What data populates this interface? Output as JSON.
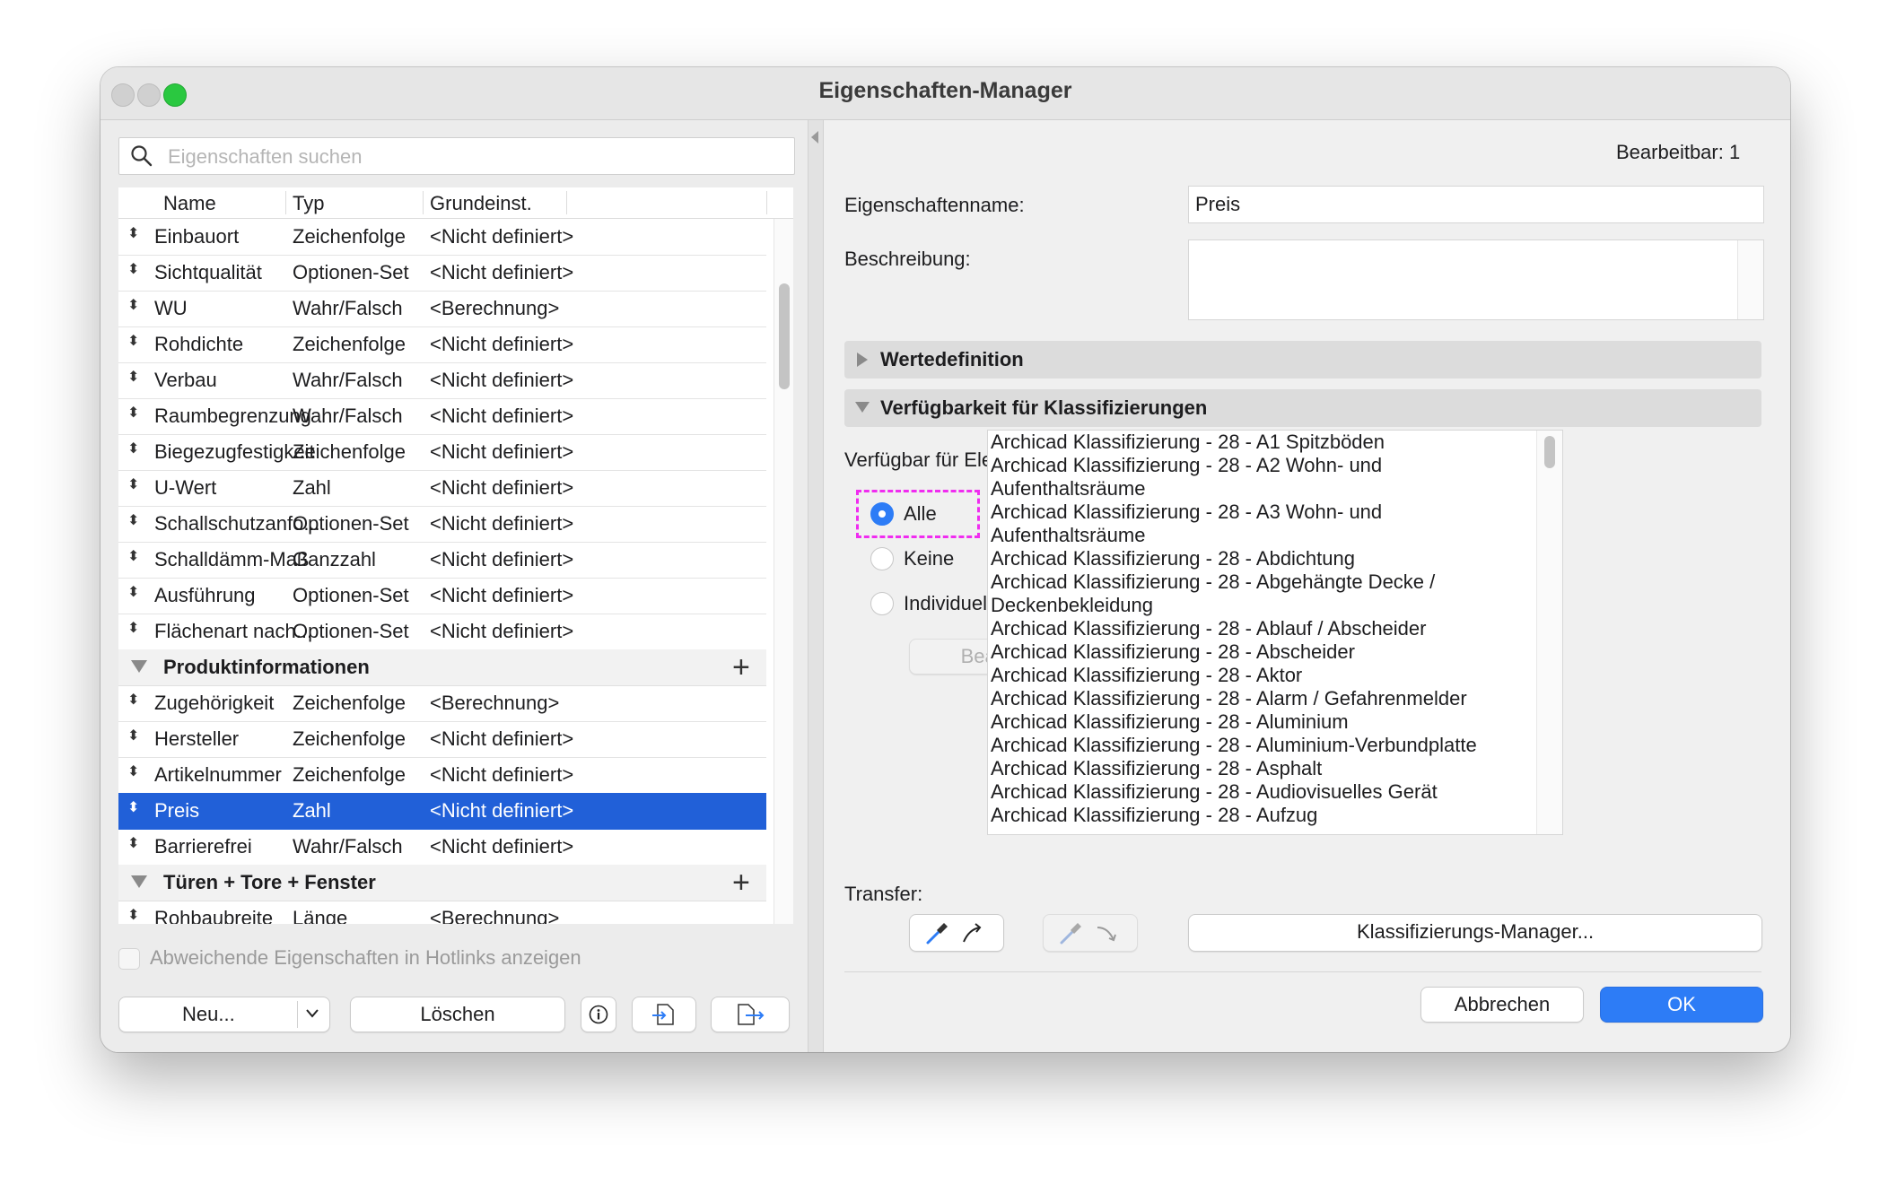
{
  "window": {
    "title": "Eigenschaften-Manager"
  },
  "search": {
    "placeholder": "Eigenschaften suchen"
  },
  "table": {
    "columns": [
      "Name",
      "Typ",
      "Grundeinst."
    ],
    "rows_top": [
      {
        "name": "Einbauort",
        "type": "Zeichenfolge",
        "default": "<Nicht definiert>"
      },
      {
        "name": "Sichtqualität",
        "type": "Optionen-Set",
        "default": "<Nicht definiert>"
      },
      {
        "name": "WU",
        "type": "Wahr/Falsch",
        "default": "<Berechnung>"
      },
      {
        "name": "Rohdichte",
        "type": "Zeichenfolge",
        "default": "<Nicht definiert>"
      },
      {
        "name": "Verbau",
        "type": "Wahr/Falsch",
        "default": "<Nicht definiert>"
      },
      {
        "name": "Raumbegrenzung",
        "type": "Wahr/Falsch",
        "default": "<Nicht definiert>"
      },
      {
        "name": "Biegezugfestigkeit",
        "type": "Zeichenfolge",
        "default": "<Nicht definiert>"
      },
      {
        "name": "U-Wert",
        "type": "Zahl",
        "default": "<Nicht definiert>"
      },
      {
        "name": "Schallschutzanfo...",
        "type": "Optionen-Set",
        "default": "<Nicht definiert>"
      },
      {
        "name": "Schalldämm-Maß",
        "type": "Ganzzahl",
        "default": "<Nicht definiert>"
      },
      {
        "name": "Ausführung",
        "type": "Optionen-Set",
        "default": "<Nicht definiert>"
      },
      {
        "name": "Flächenart nach...",
        "type": "Optionen-Set",
        "default": "<Nicht definiert>"
      }
    ],
    "group1": "Produktinformationen",
    "rows_group1": [
      {
        "name": "Zugehörigkeit",
        "type": "Zeichenfolge",
        "default": "<Berechnung>"
      },
      {
        "name": "Hersteller",
        "type": "Zeichenfolge",
        "default": "<Nicht definiert>"
      },
      {
        "name": "Artikelnummer",
        "type": "Zeichenfolge",
        "default": "<Nicht definiert>"
      },
      {
        "name": "Preis",
        "type": "Zahl",
        "default": "<Nicht definiert>"
      },
      {
        "name": "Barrierefrei",
        "type": "Wahr/Falsch",
        "default": "<Nicht definiert>"
      }
    ],
    "group2": "Türen + Tore + Fenster",
    "rows_group2": [
      {
        "name": "Rohbaubreite",
        "type": "Länge",
        "default": "<Berechnung>"
      }
    ]
  },
  "hotlinks_checkbox": "Abweichende Eigenschaften in Hotlinks anzeigen",
  "buttons_left": {
    "new": "Neu...",
    "delete": "Löschen"
  },
  "editable": "Bearbeitbar: 1",
  "prop_name_label": "Eigenschaftenname:",
  "prop_name_value": "Preis",
  "description_label": "Beschreibung:",
  "sections": {
    "values": "Wertedefinition",
    "availability": "Verfügbarkeit für Klassifizierungen"
  },
  "availability_text": "Verfügbar für Elemente mit den folgenden Klassifizierungen:",
  "radio": {
    "all": "Alle",
    "none": "Keine",
    "custom": "Individuell",
    "selected": "Alle"
  },
  "edit_button": "Bearbeiten...",
  "classifications": [
    "Archicad Klassifizierung - 28 - A1 Spitzböden",
    "Archicad Klassifizierung - 28 - A2 Wohn- und",
    "Aufenthaltsräume",
    "Archicad Klassifizierung - 28 - A3 Wohn- und",
    "Aufenthaltsräume",
    "Archicad Klassifizierung - 28 - Abdichtung",
    "Archicad Klassifizierung - 28 - Abgehängte Decke /",
    "Deckenbekleidung",
    "Archicad Klassifizierung - 28 - Ablauf / Abscheider",
    "Archicad Klassifizierung - 28 - Abscheider",
    "Archicad Klassifizierung - 28 - Aktor",
    "Archicad Klassifizierung - 28 - Alarm / Gefahrenmelder",
    "Archicad Klassifizierung - 28 - Aluminium",
    "Archicad Klassifizierung - 28 - Aluminium-Verbundplatte",
    "Archicad Klassifizierung - 28 - Asphalt",
    "Archicad Klassifizierung - 28 - Audiovisuelles Gerät",
    "Archicad Klassifizierung - 28 - Aufzug"
  ],
  "transfer_label": "Transfer:",
  "class_manager_button": "Klassifizierungs-Manager...",
  "cancel_button": "Abbrechen",
  "ok_button": "OK",
  "colors": {
    "accent": "#2d7cf6",
    "selection": "#2160d8",
    "highlight": "#f02cf0"
  }
}
